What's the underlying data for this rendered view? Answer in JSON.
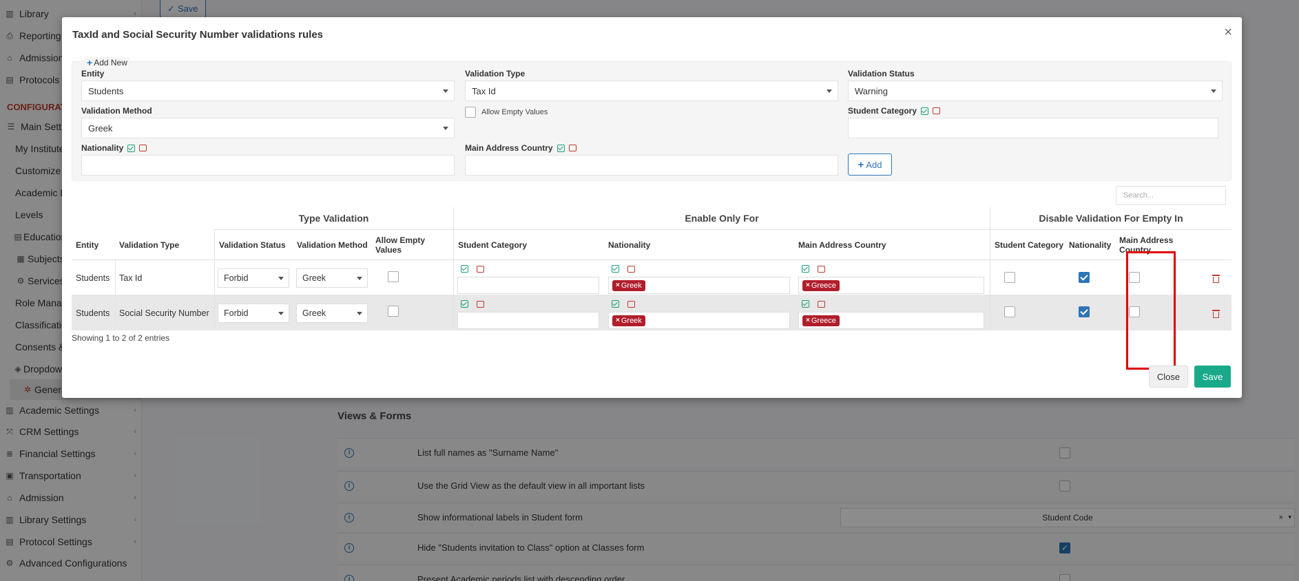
{
  "background": {
    "top_save_label": "Save",
    "sidebar": [
      {
        "label": "Library",
        "icon": "books-icon"
      },
      {
        "label": "Reporting",
        "icon": "printer-icon"
      },
      {
        "label": "Admission",
        "icon": "building-icon"
      },
      {
        "label": "Protocols",
        "icon": "protocols-icon"
      },
      {
        "label": "CONFIGURAT"
      },
      {
        "label": "Main Setti",
        "icon": "sliders-icon"
      },
      {
        "label": "My Institute"
      },
      {
        "label": "Customize T"
      },
      {
        "label": "Academic P"
      },
      {
        "label": "Levels"
      },
      {
        "label": "Education",
        "icon": "book-icon"
      },
      {
        "label": "Subjects",
        "icon": "subjects-icon"
      },
      {
        "label": "Services",
        "icon": "services-icon"
      },
      {
        "label": "Role Manag"
      },
      {
        "label": "Classificatio"
      },
      {
        "label": "Consents &"
      },
      {
        "label": "Dropdow",
        "icon": "layers-icon"
      },
      {
        "label": "General",
        "icon": "cog-icon"
      },
      {
        "label": "Academic Settings",
        "icon": "chart-icon"
      },
      {
        "label": "CRM Settings",
        "icon": "crm-icon"
      },
      {
        "label": "Financial Settings",
        "icon": "database-icon"
      },
      {
        "label": "Transportation",
        "icon": "bus-icon"
      },
      {
        "label": "Admission",
        "icon": "building-icon"
      },
      {
        "label": "Library Settings",
        "icon": "books-icon"
      },
      {
        "label": "Protocol Settings",
        "icon": "protocols-icon"
      },
      {
        "label": "Advanced Configurations",
        "icon": "gears-icon"
      }
    ],
    "views_forms": {
      "title": "Views & Forms",
      "rows": [
        {
          "label": "List full names as \"Surname Name\"",
          "checked": false
        },
        {
          "label": "Use the Grid View as the default view in all important lists",
          "checked": false
        },
        {
          "label": "Show informational labels in Student form",
          "select": "Student Code"
        },
        {
          "label": "Hide \"Students invitation to Class\" option at Classes form",
          "checked": true
        },
        {
          "label": "Present Academic periods list with descending order",
          "checked": false
        }
      ]
    }
  },
  "modal": {
    "title": "TaxId and Social Security Number validations rules",
    "add_new": "Add New",
    "form": {
      "entity_label": "Entity",
      "entity_value": "Students",
      "validation_type_label": "Validation Type",
      "validation_type_value": "Tax Id",
      "validation_status_label": "Validation Status",
      "validation_status_value": "Warning",
      "validation_method_label": "Validation Method",
      "validation_method_value": "Greek",
      "allow_empty_label": "Allow Empty Values",
      "student_category_label": "Student Category",
      "nationality_label": "Nationality",
      "main_address_country_label": "Main Address Country",
      "add_button": "Add"
    },
    "search_placeholder": "Search...",
    "table": {
      "groups": {
        "type_validation": "Type Validation",
        "enable_only_for": "Enable Only For",
        "disable_validation": "Disable Validation For Empty In"
      },
      "headers": {
        "entity": "Entity",
        "validation_type": "Validation Type",
        "validation_status": "Validation Status",
        "validation_method": "Validation Method",
        "allow_empty": "Allow Empty Values",
        "student_category": "Student Category",
        "nationality": "Nationality",
        "main_address_country": "Main Address Country",
        "dis_student_category": "Student Category",
        "dis_nationality": "Nationality",
        "dis_main_address_country": "Main Address Country"
      },
      "rows": [
        {
          "entity": "Students",
          "validation_type": "Tax Id",
          "validation_status": "Forbid",
          "validation_method": "Greek",
          "allow_empty": false,
          "nationality_tag": "Greek",
          "country_tag": "Greece",
          "dis_student_category": false,
          "dis_nationality": true,
          "dis_main_address_country": false
        },
        {
          "entity": "Students",
          "validation_type": "Social Security Number",
          "validation_status": "Forbid",
          "validation_method": "Greek",
          "allow_empty": false,
          "nationality_tag": "Greek",
          "country_tag": "Greece",
          "dis_student_category": false,
          "dis_nationality": true,
          "dis_main_address_country": false
        }
      ]
    },
    "entries_text": "Showing 1 to 2 of 2 entries",
    "close_button": "Close",
    "save_button": "Save"
  }
}
